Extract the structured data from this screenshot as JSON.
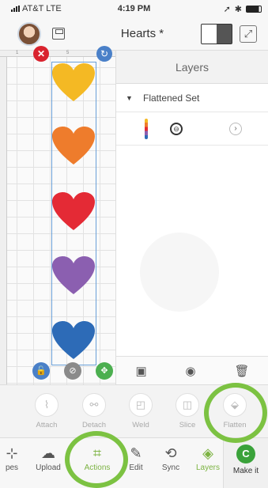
{
  "status_bar": {
    "carrier": "AT&T",
    "network": "LTE",
    "time": "4:19 PM"
  },
  "header": {
    "title": "Hearts *"
  },
  "canvas": {
    "ruler_marks": [
      "1",
      "5"
    ],
    "hearts": [
      {
        "color": "#f4b924"
      },
      {
        "color": "#ee7c2c"
      },
      {
        "color": "#e42a35"
      },
      {
        "color": "#8b5fb0"
      },
      {
        "color": "#2d6bb7"
      }
    ]
  },
  "layers": {
    "title": "Layers",
    "group_label": "Flattened Set",
    "tools": [
      "group-icon",
      "eye-icon",
      "trash-icon"
    ]
  },
  "actions": {
    "items": [
      {
        "label": "Attach",
        "icon": "attach-icon"
      },
      {
        "label": "Detach",
        "icon": "detach-icon"
      },
      {
        "label": "Weld",
        "icon": "weld-icon"
      },
      {
        "label": "Slice",
        "icon": "slice-icon"
      },
      {
        "label": "Flatten",
        "icon": "flatten-icon"
      }
    ]
  },
  "bottom_nav": {
    "items": [
      {
        "label": "pes",
        "icon": "shapes-icon"
      },
      {
        "label": "Upload",
        "icon": "upload-icon"
      },
      {
        "label": "Actions",
        "icon": "actions-icon",
        "active": true
      },
      {
        "label": "Edit",
        "icon": "edit-icon"
      },
      {
        "label": "Sync",
        "icon": "sync-icon"
      },
      {
        "label": "Layers",
        "icon": "layers-icon",
        "active": true
      }
    ],
    "make_it": "Make it"
  },
  "colors": {
    "accent_green": "#7cc242",
    "active_label": "#7cb342"
  }
}
